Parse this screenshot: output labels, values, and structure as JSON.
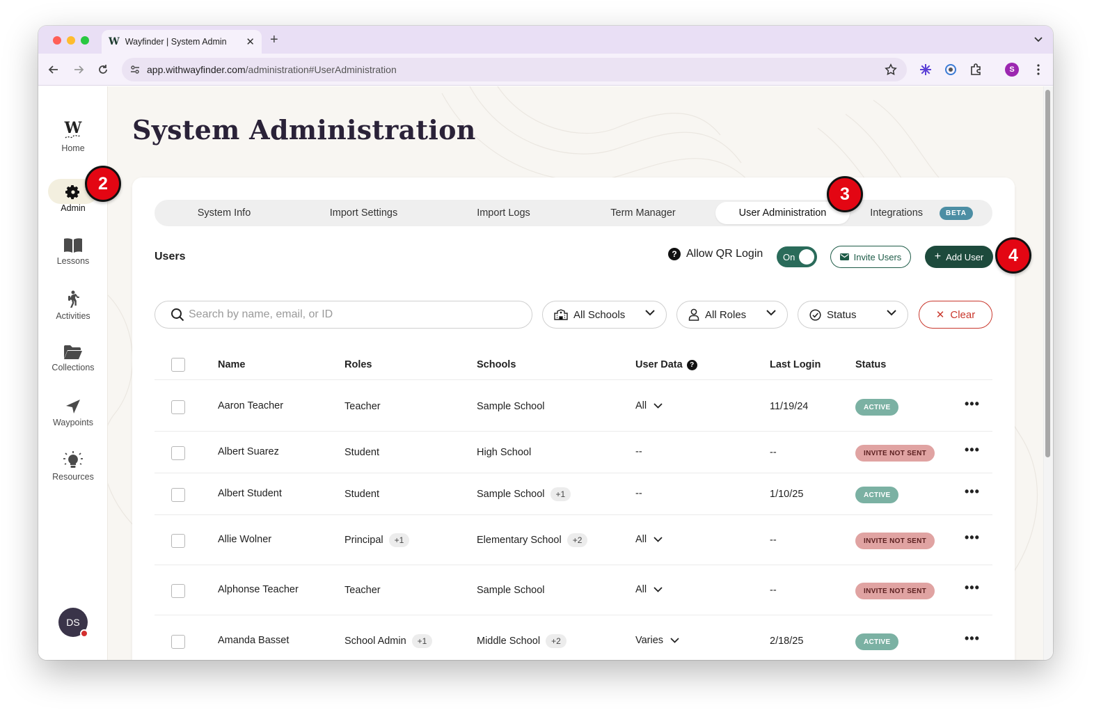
{
  "browser": {
    "tab_title": "Wayfinder | System Admin",
    "tab_favicon": "W",
    "url_host": "app.withwayfinder.com",
    "url_path": "/administration#UserAdministration",
    "profile_initial": "S"
  },
  "sidebar": {
    "logo_letter": "W",
    "items": [
      {
        "label": "Home",
        "icon": "wayfinder-logo-icon"
      },
      {
        "label": "Admin",
        "icon": "gear-icon"
      },
      {
        "label": "Lessons",
        "icon": "book-icon"
      },
      {
        "label": "Activities",
        "icon": "hiker-icon"
      },
      {
        "label": "Collections",
        "icon": "folder-icon"
      },
      {
        "label": "Waypoints",
        "icon": "navigation-arrow-icon"
      },
      {
        "label": "Resources",
        "icon": "lightbulb-icon"
      }
    ],
    "avatar_initials": "DS"
  },
  "page": {
    "title": "System Administration"
  },
  "tabs": [
    {
      "label": "System Info"
    },
    {
      "label": "Import Settings"
    },
    {
      "label": "Import Logs"
    },
    {
      "label": "Term Manager"
    },
    {
      "label": "User Administration",
      "active": true
    },
    {
      "label": "Integrations",
      "badge": "BETA"
    }
  ],
  "users_section": {
    "heading": "Users",
    "qr_login_label": "Allow QR Login",
    "qr_toggle_label": "On",
    "invite_label": "Invite Users",
    "add_label": "Add User"
  },
  "filters": {
    "search_placeholder": "Search by name, email, or ID",
    "schools": "All Schools",
    "roles": "All Roles",
    "status": "Status",
    "clear": "Clear"
  },
  "table": {
    "headers": [
      "Name",
      "Roles",
      "Schools",
      "User Data",
      "Last Login",
      "Status"
    ],
    "rows": [
      {
        "name": "Aaron Teacher",
        "role": "Teacher",
        "role_extra": "",
        "school": "Sample School",
        "school_extra": "",
        "user_data": "All",
        "user_data_dropdown": true,
        "last_login": "11/19/24",
        "status": "ACTIVE"
      },
      {
        "name": "Albert Suarez",
        "role": "Student",
        "role_extra": "",
        "school": "High School",
        "school_extra": "",
        "user_data": "--",
        "user_data_dropdown": false,
        "last_login": "--",
        "status": "INVITE NOT SENT"
      },
      {
        "name": "Albert Student",
        "role": "Student",
        "role_extra": "",
        "school": "Sample School",
        "school_extra": "+1",
        "user_data": "--",
        "user_data_dropdown": false,
        "last_login": "1/10/25",
        "status": "ACTIVE"
      },
      {
        "name": "Allie Wolner",
        "role": "Principal",
        "role_extra": "+1",
        "school": "Elementary School",
        "school_extra": "+2",
        "user_data": "All",
        "user_data_dropdown": true,
        "last_login": "--",
        "status": "INVITE NOT SENT"
      },
      {
        "name": "Alphonse Teacher",
        "role": "Teacher",
        "role_extra": "",
        "school": "Sample School",
        "school_extra": "",
        "user_data": "All",
        "user_data_dropdown": true,
        "last_login": "--",
        "status": "INVITE NOT SENT"
      },
      {
        "name": "Amanda Basset",
        "role": "School Admin",
        "role_extra": "+1",
        "school": "Middle School",
        "school_extra": "+2",
        "user_data": "Varies",
        "user_data_dropdown": true,
        "last_login": "2/18/25",
        "status": "ACTIVE"
      }
    ]
  },
  "callouts": [
    "2",
    "3",
    "4"
  ],
  "colors": {
    "brand_green": "#1d4a3c",
    "toggle_green": "#2a6b5a",
    "active_badge": "#7bb1a3",
    "invite_badge": "#e0a3a2",
    "clear_red": "#c9372c",
    "callout_red": "#e30613"
  }
}
